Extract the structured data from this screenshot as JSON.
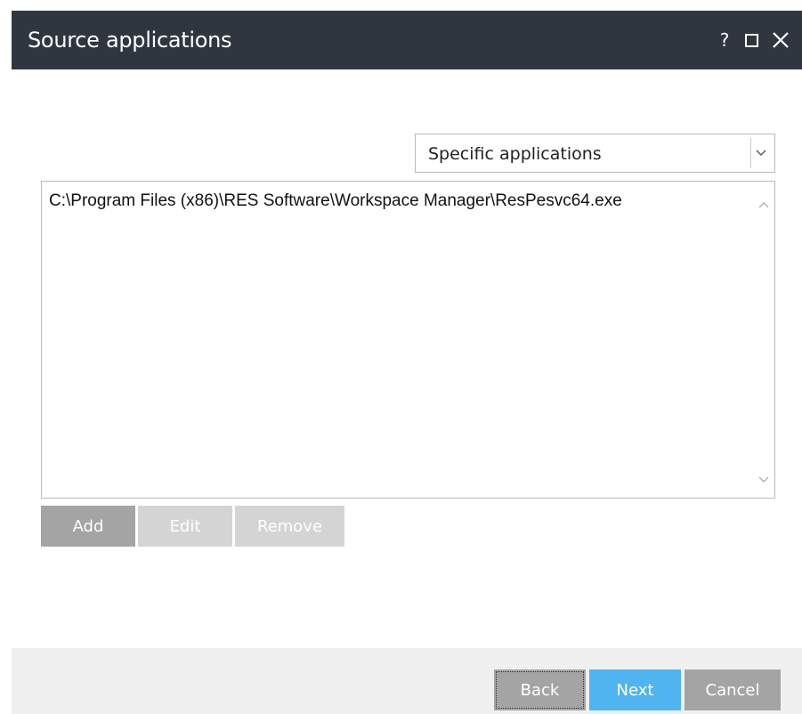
{
  "window": {
    "title": "Source applications",
    "controls": {
      "help": "?",
      "maximize_icon": "maximize-icon",
      "close_icon": "close-icon"
    }
  },
  "filter": {
    "selected": "Specific applications",
    "icon": "chevron-down-icon"
  },
  "applications": {
    "items": [
      "C:\\Program Files (x86)\\RES Software\\Workspace Manager\\ResPesvc64.exe"
    ]
  },
  "list_actions": {
    "add_label": "Add",
    "edit_label": "Edit",
    "remove_label": "Remove"
  },
  "footer": {
    "back_label": "Back",
    "next_label": "Next",
    "cancel_label": "Cancel"
  },
  "colors": {
    "titlebar": "#2f3640",
    "accent": "#4fb4ef",
    "button_gray": "#a4a4a4",
    "button_disabled": "#d4d4d4"
  }
}
